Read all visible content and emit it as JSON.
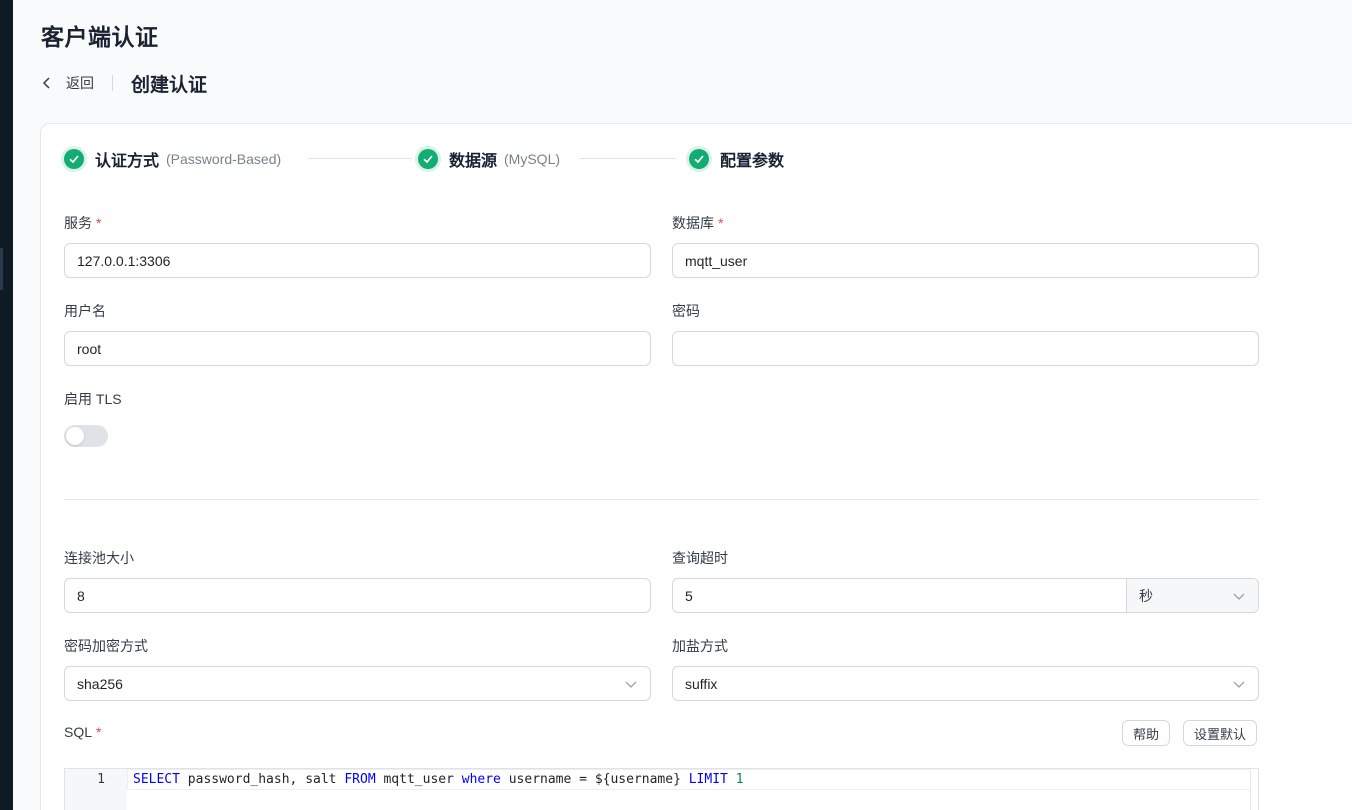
{
  "page": {
    "title": "客户端认证",
    "back_label": "返回",
    "sub_title": "创建认证"
  },
  "steps": [
    {
      "name": "认证方式",
      "sub": "(Password-Based)",
      "status": "done"
    },
    {
      "name": "数据源",
      "sub": "(MySQL)",
      "status": "done"
    },
    {
      "name": "配置参数",
      "sub": "",
      "status": "done"
    }
  ],
  "form": {
    "server": {
      "label": "服务",
      "required": true,
      "value": "127.0.0.1:3306"
    },
    "database": {
      "label": "数据库",
      "required": true,
      "value": "mqtt_user"
    },
    "username": {
      "label": "用户名",
      "value": "root"
    },
    "password": {
      "label": "密码",
      "value": ""
    },
    "tls": {
      "label": "启用 TLS",
      "enabled": false
    },
    "pool_size": {
      "label": "连接池大小",
      "value": "8"
    },
    "query_timeout": {
      "label": "查询超时",
      "value": "5",
      "unit": "秒"
    },
    "password_hash": {
      "label": "密码加密方式",
      "value": "sha256"
    },
    "salt_position": {
      "label": "加盐方式",
      "value": "suffix"
    },
    "sql": {
      "label": "SQL",
      "required": true,
      "help_label": "帮助",
      "reset_label": "设置默认",
      "line_number": "1",
      "tokens": {
        "select": "SELECT",
        "part1": " password_hash, salt ",
        "from": "FROM",
        "part2": " mqtt_user ",
        "where": "where",
        "part3": " username = ",
        "placeholder": "${username}",
        "part4": " ",
        "limit": "LIMIT",
        "part5": " ",
        "limit_value": "1"
      }
    }
  },
  "colors": {
    "success": "#13ac73",
    "required": "#e5484d",
    "keyword": "#0000ff",
    "number": "#098658"
  }
}
